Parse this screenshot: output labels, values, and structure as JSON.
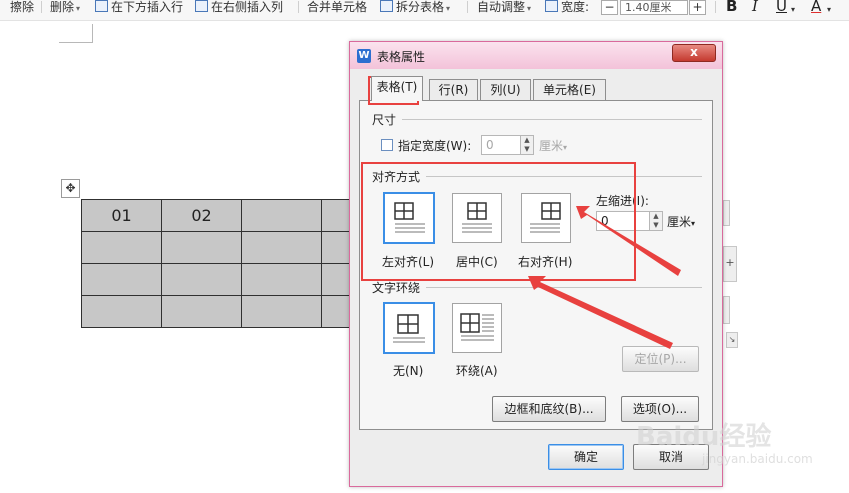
{
  "toolbar": {
    "erase": "擦除",
    "delete": "删除",
    "insert_row_below": "在下方插入行",
    "insert_col_right": "在右侧插入列",
    "merge_cells": "合并单元格",
    "split_table": "拆分表格",
    "auto_fit": "自动调整",
    "width_label": "宽度:",
    "width_value": "1.40厘米",
    "minus": "−",
    "plus": "+",
    "bold": "B",
    "italic": "I",
    "underline": "U",
    "font_color": "A"
  },
  "document": {
    "table_rows": [
      [
        "01",
        "02",
        "",
        ""
      ],
      [
        "",
        "",
        "",
        ""
      ],
      [
        "",
        "",
        "",
        ""
      ],
      [
        "",
        "",
        "",
        ""
      ]
    ],
    "add_button": "+"
  },
  "dialog": {
    "title": "表格属性",
    "app_icon": "W",
    "close_label": "x",
    "tabs": [
      {
        "label": "表格(T)"
      },
      {
        "label": "行(R)"
      },
      {
        "label": "列(U)"
      },
      {
        "label": "单元格(E)"
      }
    ],
    "size": {
      "heading": "尺寸",
      "specify_width_label": "指定宽度(W):",
      "width_value": "0",
      "unit": "厘米"
    },
    "alignment": {
      "heading": "对齐方式",
      "options": [
        {
          "label": "左对齐(L)"
        },
        {
          "label": "居中(C)"
        },
        {
          "label": "右对齐(H)"
        }
      ],
      "indent_label": "左缩进(I):",
      "indent_value": "0",
      "indent_unit": "厘米"
    },
    "wrap": {
      "heading": "文字环绕",
      "options": [
        {
          "label": "无(N)"
        },
        {
          "label": "环绕(A)"
        }
      ],
      "position_button": "定位(P)..."
    },
    "borders_button": "边框和底纹(B)...",
    "options_button": "选项(O)...",
    "ok_button": "确定",
    "cancel_button": "取消"
  },
  "watermark": {
    "brand": "Baidu经验",
    "url": "jingyan.baidu.com"
  },
  "colors": {
    "highlight": "#e8413f",
    "selection": "#3a8ee6",
    "dialog_border": "#d96a9c"
  }
}
